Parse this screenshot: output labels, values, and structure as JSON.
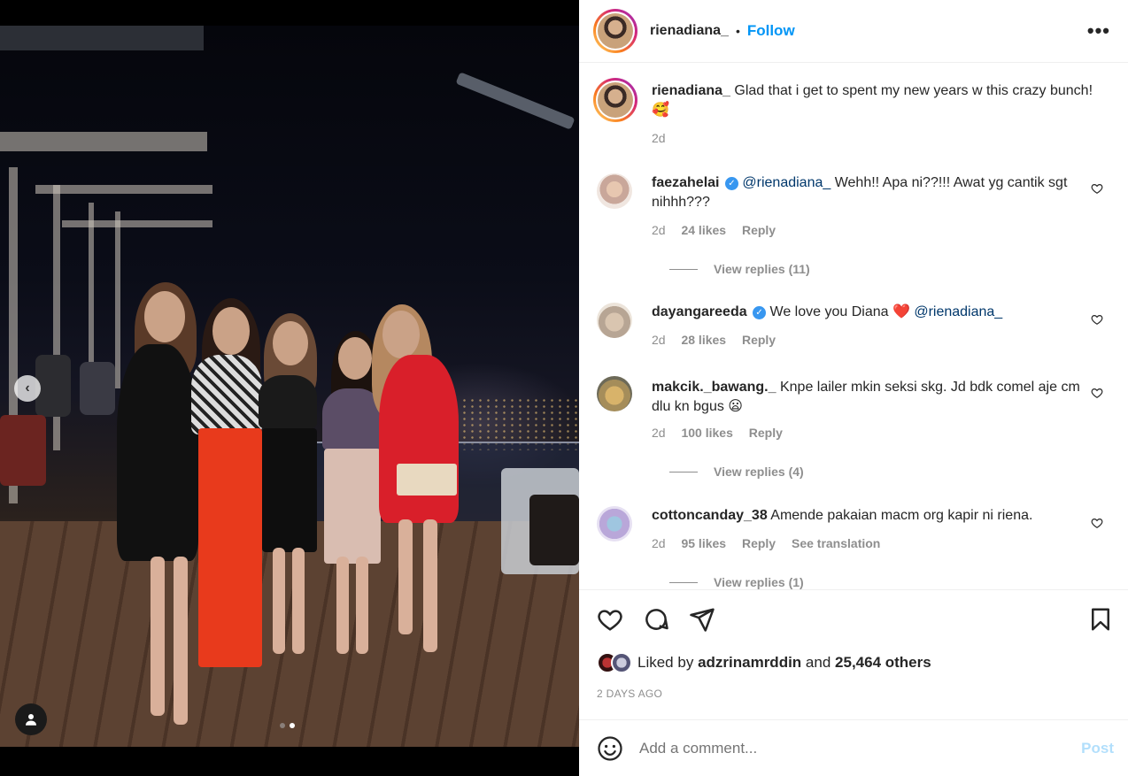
{
  "post": {
    "author": "rienadiana_",
    "follow_label": "Follow",
    "separator": "•",
    "more_label": "•••",
    "caption_text": "Glad that i get to spent my new years w this crazy bunch! 🥰",
    "caption_time": "2d"
  },
  "comments": [
    {
      "user": "faezahelai",
      "verified": true,
      "mention": "@rienadiana_",
      "text": " Wehh!! Apa ni??!!! Awat yg cantik sgt nihhh???",
      "time": "2d",
      "likes": "24 likes",
      "reply": "Reply",
      "view_replies": "View replies (11)"
    },
    {
      "user": "dayangareeda",
      "verified": true,
      "text": "We love you Diana ❤️ ",
      "mention": "@rienadiana_",
      "time": "2d",
      "likes": "28 likes",
      "reply": "Reply"
    },
    {
      "user": "makcik._bawang._",
      "verified": false,
      "text": "Knpe lailer mkin seksi skg. Jd bdk comel aje cm dlu kn bgus 😦",
      "time": "2d",
      "likes": "100 likes",
      "reply": "Reply",
      "view_replies": "View replies (4)"
    },
    {
      "user": "cottoncanday_38",
      "verified": false,
      "text": "Amende pakaian macm org kapir ni riena.",
      "time": "2d",
      "likes": "95 likes",
      "reply": "Reply",
      "translate": "See translation",
      "view_replies": "View replies (1)"
    }
  ],
  "liked_by": {
    "prefix": "Liked by",
    "user": "adzrinamrddin",
    "middle": "and",
    "others": "25,464 others"
  },
  "timestamp": "2 DAYS AGO",
  "add_comment": {
    "placeholder": "Add a comment...",
    "post_label": "Post"
  },
  "icons": {
    "carousel_prev": "chevron-left-icon",
    "user_tag": "person-icon",
    "like": "heart-icon",
    "comment": "speech-bubble-icon",
    "share": "paper-plane-icon",
    "save": "bookmark-icon",
    "emoji": "smiley-icon",
    "more": "ellipsis-icon"
  },
  "carousel": {
    "total": 2,
    "active": 2
  },
  "colors": {
    "follow": "#0095f6",
    "post_disabled": "#b2dffc",
    "mention": "#00376b",
    "meta": "#8e8e8e",
    "verified": "#3897f0"
  }
}
